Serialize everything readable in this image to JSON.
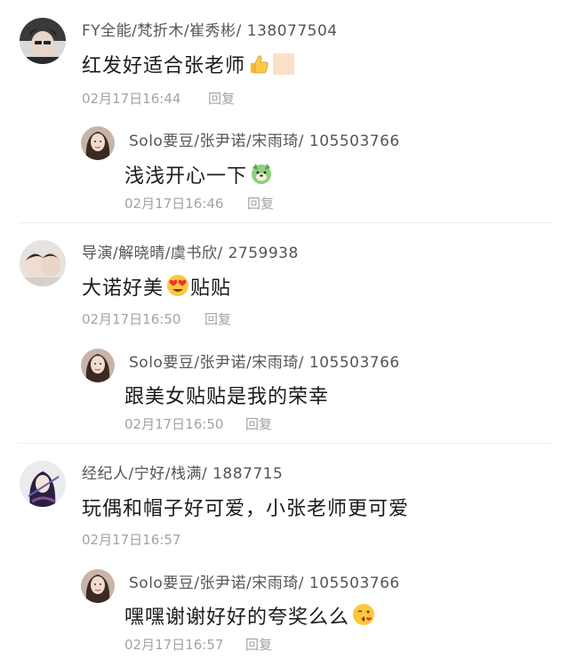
{
  "threads": [
    {
      "comment": {
        "username": "FY全能/梵折木/崔秀彬/ 138077504",
        "text": "红发好适合张老师",
        "time": "02月17日16:44",
        "reply_label": "回复"
      },
      "reply": {
        "username": "Solo要豆/张尹诺/宋雨琦/ 105503766",
        "text": "浅浅开心一下",
        "time": "02月17日16:46",
        "reply_label": "回复"
      }
    },
    {
      "comment": {
        "username": "导演/解晓晴/虞书欣/ 2759938",
        "text_before": "大诺好美",
        "text_after": "贴贴",
        "time": "02月17日16:50",
        "reply_label": "回复"
      },
      "reply": {
        "username": "Solo要豆/张尹诺/宋雨琦/ 105503766",
        "text": "跟美女贴贴是我的荣幸",
        "time": "02月17日16:50",
        "reply_label": "回复"
      }
    },
    {
      "comment": {
        "username": "经纪人/宁好/栈满/ 1887715",
        "text": "玩偶和帽子好可爱，小张老师更可爱",
        "time": "02月17日16:57",
        "reply_label": ""
      },
      "reply": {
        "username": "Solo要豆/张尹诺/宋雨琦/ 105503766",
        "text": "嘿嘿谢谢好好的夸奖么么",
        "time": "02月17日16:57",
        "reply_label": "回复"
      }
    }
  ],
  "icons": {
    "thumbs_up": "thumbs-up-emoji",
    "skin_tone": "skin-tone-swatch",
    "dog": "dog-face-emoji",
    "heart_eyes": "heart-eyes-emoji",
    "kiss": "kissing-face-emoji"
  },
  "colors": {
    "meta": "#a3a3a3",
    "username": "#555555",
    "text": "#1a1a1a",
    "divider": "#ededed"
  }
}
